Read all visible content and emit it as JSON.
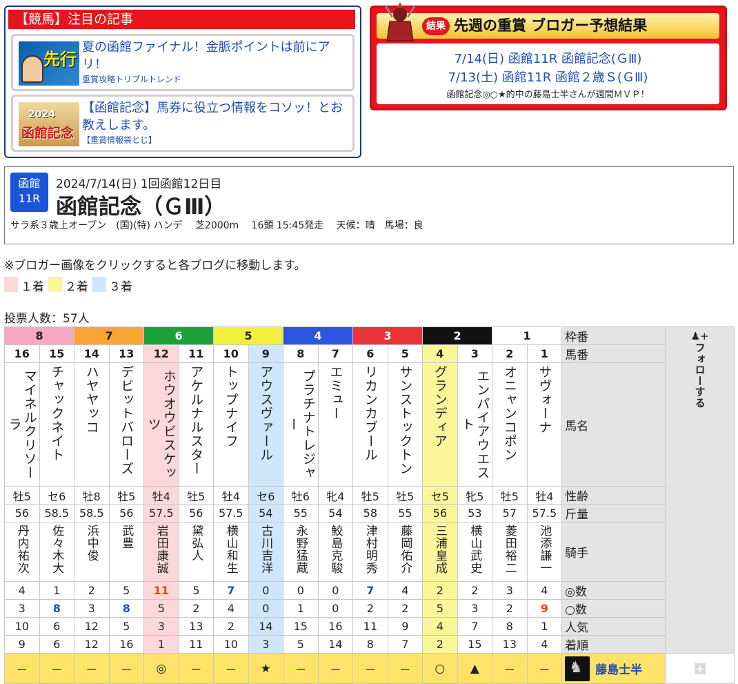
{
  "articles": {
    "header": "【競馬】注目の記事",
    "items": [
      {
        "title": "夏の函館ファイナル！金脈ポイントは前にアリ！",
        "source": "重賞攻略トリプルトレンド",
        "thumb_label": "先行"
      },
      {
        "title": "【函館記念】馬券に役立つ情報をコソッ！とお教えします。",
        "source": "【重賞情報袋とじ】",
        "thumb_label": "函館記念",
        "thumb_year": "2024"
      }
    ]
  },
  "results": {
    "badge": "結果",
    "title": "先週の重賞 ブロガー予想結果",
    "lines": [
      "7/14(日) 函館11R 函館記念(ＧⅢ)",
      "7/13(土) 函館11R 函館２歳Ｓ(ＧⅢ)"
    ],
    "mvp": "函館記念◎○★的中の藤島士半さんが週間ＭＶＰ！"
  },
  "race": {
    "venue": "函館",
    "rnum": "11R",
    "date": "2024/7/14(日) 1回函館12日目",
    "name": "函館記念（ＧⅢ）",
    "cond": "サラ系３歳上オープン　(国)(特) ハンデ　 芝2000m　 16頭 15:45発走　 天候：晴　馬場：良"
  },
  "notice": "※ブロガー画像をクリックすると各ブログに移動します。",
  "legend": [
    "１着",
    "２着",
    "３着"
  ],
  "votes": "投票人数：57人",
  "labels": {
    "waku": "枠番",
    "uma": "馬番",
    "name": "馬名",
    "sexage": "性齢",
    "weight": "斤量",
    "jockey": "騎手",
    "hon": "◎数",
    "tai": "○数",
    "pop": "人気",
    "fin": "着順",
    "follow": "フォローする"
  },
  "waku": [
    {
      "n": "8",
      "span": 2,
      "bg": "#f6a7c4",
      "fg": "#222"
    },
    {
      "n": "7",
      "span": 2,
      "bg": "#f9a433",
      "fg": "#222"
    },
    {
      "n": "6",
      "span": 2,
      "bg": "#19a23c",
      "fg": "#fff"
    },
    {
      "n": "5",
      "span": 2,
      "bg": "#f2f03a",
      "fg": "#222"
    },
    {
      "n": "4",
      "span": 2,
      "bg": "#2c55e0",
      "fg": "#fff"
    },
    {
      "n": "3",
      "span": 2,
      "bg": "#e8333a",
      "fg": "#fff"
    },
    {
      "n": "2",
      "span": 2,
      "bg": "#111111",
      "fg": "#fff"
    },
    {
      "n": "1",
      "span": 2,
      "bg": "#ffffff",
      "fg": "#222"
    }
  ],
  "horses": [
    {
      "num": "16",
      "name": "マイネルクリソーラ",
      "sa": "牡5",
      "wt": "56",
      "jk": "丹内祐次",
      "hon": "4",
      "tai": "3",
      "pop": "10",
      "fin": "9",
      "pred": "－",
      "hl": ""
    },
    {
      "num": "15",
      "name": "チャックネイト",
      "sa": "セ6",
      "wt": "58.5",
      "jk": "佐々木大",
      "hon": "1",
      "tai": "8",
      "pop": "6",
      "fin": "6",
      "pred": "－",
      "hl": "",
      "taiC": "blue"
    },
    {
      "num": "14",
      "name": "ハヤヤッコ",
      "sa": "牡8",
      "wt": "58.5",
      "jk": "浜中俊",
      "hon": "2",
      "tai": "3",
      "pop": "12",
      "fin": "12",
      "pred": "－",
      "hl": ""
    },
    {
      "num": "13",
      "name": "デビットバローズ",
      "sa": "牡5",
      "wt": "56",
      "jk": "武豊",
      "hon": "5",
      "tai": "8",
      "pop": "5",
      "fin": "16",
      "pred": "－",
      "hl": "",
      "taiC": "blue"
    },
    {
      "num": "12",
      "name": "ホウオウビスケッツ",
      "sa": "牡4",
      "wt": "57.5",
      "jk": "岩田康誠",
      "hon": "11",
      "tai": "5",
      "pop": "3",
      "fin": "1",
      "pred": "◎",
      "hl": "#fcd8d8",
      "honC": "red"
    },
    {
      "num": "11",
      "name": "アケルナルスター",
      "sa": "牡5",
      "wt": "56",
      "jk": "黛弘人",
      "hon": "5",
      "tai": "2",
      "pop": "13",
      "fin": "11",
      "pred": "－",
      "hl": ""
    },
    {
      "num": "10",
      "name": "トップナイフ",
      "sa": "牡4",
      "wt": "57.5",
      "jk": "横山和生",
      "hon": "7",
      "tai": "4",
      "pop": "2",
      "fin": "10",
      "pred": "－",
      "hl": "",
      "honC": "blue"
    },
    {
      "num": "9",
      "name": "アウスヴァール",
      "sa": "セ6",
      "wt": "54",
      "jk": "古川吉洋",
      "hon": "0",
      "tai": "0",
      "pop": "14",
      "fin": "3",
      "pred": "★",
      "hl": "#cfe6fb"
    },
    {
      "num": "8",
      "name": "プラチナトレジャー",
      "sa": "牡6",
      "wt": "55",
      "jk": "永野猛蔵",
      "hon": "0",
      "tai": "1",
      "pop": "15",
      "fin": "5",
      "pred": "－",
      "hl": ""
    },
    {
      "num": "7",
      "name": "エミュー",
      "sa": "牝4",
      "wt": "54",
      "jk": "鮫島克駿",
      "hon": "0",
      "tai": "0",
      "pop": "16",
      "fin": "14",
      "pred": "－",
      "hl": ""
    },
    {
      "num": "6",
      "name": "リカンカブール",
      "sa": "牡5",
      "wt": "58",
      "jk": "津村明秀",
      "hon": "7",
      "tai": "2",
      "pop": "11",
      "fin": "8",
      "pred": "－",
      "hl": "",
      "honC": "blue"
    },
    {
      "num": "5",
      "name": "サンストックトン",
      "sa": "牡5",
      "wt": "55",
      "jk": "藤岡佑介",
      "hon": "4",
      "tai": "2",
      "pop": "9",
      "fin": "7",
      "pred": "－",
      "hl": ""
    },
    {
      "num": "4",
      "name": "グランディア",
      "sa": "セ5",
      "wt": "56",
      "jk": "三浦皇成",
      "hon": "2",
      "tai": "5",
      "pop": "4",
      "fin": "2",
      "pred": "○",
      "hl": "#fbf69a"
    },
    {
      "num": "3",
      "name": "エンパイアウエスト",
      "sa": "牝5",
      "wt": "53",
      "jk": "横山武史",
      "hon": "2",
      "tai": "3",
      "pop": "7",
      "fin": "15",
      "pred": "▲",
      "hl": ""
    },
    {
      "num": "2",
      "name": "オニャンコポン",
      "sa": "牡5",
      "wt": "57",
      "jk": "菱田裕二",
      "hon": "3",
      "tai": "2",
      "pop": "8",
      "fin": "13",
      "pred": "－",
      "hl": ""
    },
    {
      "num": "1",
      "name": "サヴォーナ",
      "sa": "牡4",
      "wt": "57.5",
      "jk": "池添謙一",
      "hon": "4",
      "tai": "9",
      "pop": "1",
      "fin": "4",
      "pred": "－",
      "hl": "",
      "taiC": "red"
    }
  ],
  "blogger": {
    "name": "藤島士半"
  },
  "colors": {
    "first": "#fcd8d8",
    "second": "#fbf69a",
    "third": "#cfe6fb",
    "link": "#1d4fb0"
  }
}
